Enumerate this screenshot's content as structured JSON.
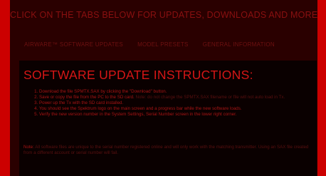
{
  "header": {
    "title": "CLICK ON THE TABS BELOW FOR UPDATES, DOWNLOADS AND MORE"
  },
  "tabs": [
    {
      "label": "AIRWARE™ SOFTWARE UPDATES"
    },
    {
      "label": "MODEL PRESETS"
    },
    {
      "label": "GENERAL INFORMATION"
    }
  ],
  "content": {
    "title": "SOFTWARE UPDATE INSTRUCTIONS:",
    "steps": [
      {
        "text": "Download the file SPMTX.SAX by clicking the \"Download\" button."
      },
      {
        "text": "Save or copy the file from the PC to the SD card.",
        "note": "Note: do not change the SPMTX.SAX filename or file will not auto load in Tx."
      },
      {
        "text": "Power up the Tx with the SD card installed."
      },
      {
        "text": "You should see the Spektrum logo on the main screen and a progress bar while the new software loads."
      },
      {
        "text": "Verify the new version number in the System Settings, Serial Number screen in the lower right corner."
      }
    ],
    "note_label": "Note:",
    "note_text": "All software files are unique to the serial number registered online and will only work with the matching transmitter. Using an SAX file created from a different account or serial number will fail."
  },
  "colors": {
    "frame": "#cc0000",
    "panel": "#2a0000",
    "title": "#d41616"
  }
}
